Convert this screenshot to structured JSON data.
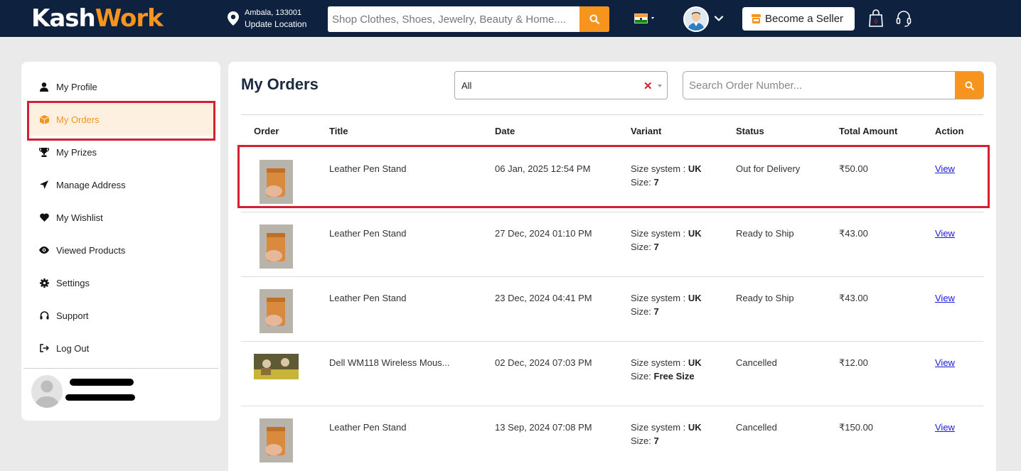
{
  "header": {
    "logo_part1": "Kash",
    "logo_part2": "Work",
    "location_line1": "Ambala, 133001",
    "location_line2": "Update Location",
    "search_placeholder": "Shop Clothes, Shoes, Jewelry, Beauty & Home....",
    "seller_button": "Become a Seller",
    "icons": [
      "location-pin-icon",
      "search-icon",
      "india-flag-icon",
      "user-avatar-icon",
      "chevron-down-icon",
      "shop-icon",
      "shopping-bag-icon",
      "headset-icon"
    ]
  },
  "sidebar": {
    "items": [
      {
        "label": "My Profile",
        "icon": "user-icon"
      },
      {
        "label": "My Orders",
        "icon": "box-icon",
        "active": true
      },
      {
        "label": "My Prizes",
        "icon": "trophy-icon"
      },
      {
        "label": "Manage Address",
        "icon": "location-arrow-icon"
      },
      {
        "label": "My Wishlist",
        "icon": "heart-icon"
      },
      {
        "label": "Viewed Products",
        "icon": "eye-icon"
      },
      {
        "label": "Settings",
        "icon": "gear-icon"
      },
      {
        "label": "Support",
        "icon": "headset-icon"
      },
      {
        "label": "Log Out",
        "icon": "logout-icon"
      }
    ]
  },
  "main": {
    "title": "My Orders",
    "filter_value": "All",
    "search_placeholder": "Search Order Number...",
    "columns": [
      "Order",
      "Title",
      "Date",
      "Variant",
      "Status",
      "Total Amount",
      "Action"
    ],
    "variant_label": "Size system : ",
    "size_label": "Size: ",
    "orders": [
      {
        "title": "Leather Pen Stand",
        "date": "06 Jan, 2025 12:54 PM",
        "size_system": "UK",
        "size": "7",
        "status": "Out for Delivery",
        "amount": "₹50.00",
        "action": "View"
      },
      {
        "title": "Leather Pen Stand",
        "date": "27 Dec, 2024 01:10 PM",
        "size_system": "UK",
        "size": "7",
        "status": "Ready to Ship",
        "amount": "₹43.00",
        "action": "View"
      },
      {
        "title": "Leather Pen Stand",
        "date": "23 Dec, 2024 04:41 PM",
        "size_system": "UK",
        "size": "7",
        "status": "Ready to Ship",
        "amount": "₹43.00",
        "action": "View"
      },
      {
        "title": "Dell WM118 Wireless Mous...",
        "date": "02 Dec, 2024 07:03 PM",
        "size_system": "UK",
        "size": "Free Size",
        "status": "Cancelled",
        "amount": "₹12.00",
        "action": "View"
      },
      {
        "title": "Leather Pen Stand",
        "date": "13 Sep, 2024 07:08 PM",
        "size_system": "UK",
        "size": "7",
        "status": "Cancelled",
        "amount": "₹150.00",
        "action": "View"
      }
    ]
  },
  "colors": {
    "header_bg": "#0e2240",
    "accent": "#f7941d",
    "highlight": "#d32032",
    "link": "#1a1adb"
  }
}
